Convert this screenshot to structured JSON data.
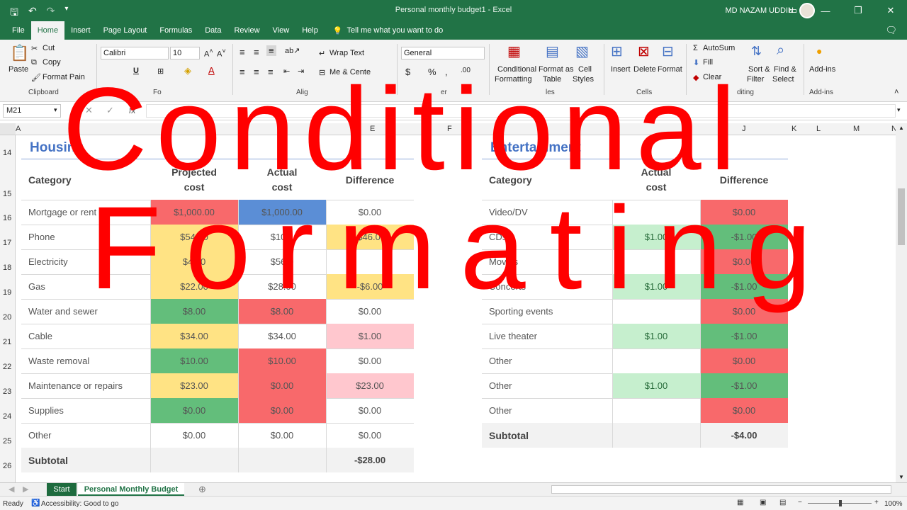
{
  "app": {
    "doc_title": "Personal monthly budget1  -  Excel",
    "user_name": "MD NAZAM UDDIN",
    "accent": "#217346"
  },
  "tabs": [
    "File",
    "Home",
    "Insert",
    "Page Layout",
    "Formulas",
    "Data",
    "Review",
    "View",
    "Help"
  ],
  "tell_me": "Tell me what you want to do",
  "ribbon": {
    "paste": "Paste",
    "cut": "Cut",
    "copy": "Copy",
    "format_painter": "Format Pain",
    "clipboard": "Clipboard",
    "font_name": "Calibri",
    "font_size": "10",
    "font_group": "Fo",
    "wrap_text": "Wrap Text",
    "merge_center": "Me  & Cente",
    "align_group": "Alig",
    "number_format": "General",
    "number_group": "er",
    "cond_format_1": "Conditional",
    "cond_format_2": "Formatting",
    "format_as_1": "Format as",
    "format_as_2": "Table",
    "cell_styles_1": "Cell",
    "cell_styles_2": "Styles",
    "styles_group": "les",
    "insert": "Insert",
    "delete": "Delete",
    "format": "Format",
    "cells_group": "Cells",
    "autosum": "AutoSum",
    "fill": "Fill",
    "clear": "Clear",
    "sort_1": "Sort &",
    "sort_2": "Filter",
    "find_1": "Find &",
    "find_2": "Select",
    "editing_group": "diting",
    "addins": "Add-ins",
    "addins_group": "Add-ins"
  },
  "formula_bar": {
    "name_box": "M21",
    "fx": "fx",
    "value": ""
  },
  "columns": [
    "A",
    "D",
    "E",
    "F",
    "J",
    "K",
    "L",
    "M",
    "N"
  ],
  "rows": [
    "14",
    "15",
    "16",
    "17",
    "18",
    "19",
    "20",
    "21",
    "22",
    "23",
    "24",
    "25",
    "26"
  ],
  "housing": {
    "title": "Housing",
    "headers": [
      "Category",
      "Projected\ncost",
      "Actual\ncost",
      "Difference"
    ],
    "rows": [
      [
        "Mortgage or rent",
        "$1,000.00",
        "$1,000.00",
        "$0.00"
      ],
      [
        "Phone",
        "$54.00",
        "$100.",
        "-$46.00"
      ],
      [
        "Electricity",
        "$44.0",
        "$56.0",
        ""
      ],
      [
        "Gas",
        "$22.00",
        "$28.00",
        "-$6.00"
      ],
      [
        "Water and sewer",
        "$8.00",
        "$8.00",
        "$0.00"
      ],
      [
        "Cable",
        "$34.00",
        "$34.00",
        "$1.00"
      ],
      [
        "Waste removal",
        "$10.00",
        "$10.00",
        "$0.00"
      ],
      [
        "Maintenance or repairs",
        "$23.00",
        "$0.00",
        "$23.00"
      ],
      [
        "Supplies",
        "$0.00",
        "$0.00",
        "$0.00"
      ],
      [
        "Other",
        "$0.00",
        "$0.00",
        "$0.00"
      ]
    ],
    "subtotal_label": "Subtotal",
    "subtotal_value": "-$28.00"
  },
  "entertainment": {
    "title": "Entertainment",
    "headers": [
      "Category",
      "Actual\ncost",
      "Difference"
    ],
    "rows": [
      [
        "Video/DV",
        "",
        "$0.00"
      ],
      [
        "CDs",
        "$1.00",
        "-$1.00"
      ],
      [
        "Movies",
        "",
        "$0.00"
      ],
      [
        "Concerts",
        "$1.00",
        "-$1.00"
      ],
      [
        "Sporting events",
        "",
        "$0.00"
      ],
      [
        "Live theater",
        "$1.00",
        "-$1.00"
      ],
      [
        "Other",
        "",
        "$0.00"
      ],
      [
        "Other",
        "$1.00",
        "-$1.00"
      ],
      [
        "Other",
        "",
        "$0.00"
      ]
    ],
    "subtotal_label": "Subtotal",
    "subtotal_value": "-$4.00"
  },
  "colors": {
    "red": "#f8696b",
    "blue": "#5b8ed6",
    "yellow": "#ffe384",
    "light_green": "#c6efce",
    "green": "#63be7b",
    "pink": "#ffc7ce"
  },
  "sheet_tabs": [
    "Start",
    "Personal Monthly Budget"
  ],
  "status": {
    "ready": "Ready",
    "accessibility": "Accessibility: Good to go",
    "zoom": "100%"
  },
  "overlay": {
    "line1": "Conditional",
    "line2": "Formating"
  }
}
